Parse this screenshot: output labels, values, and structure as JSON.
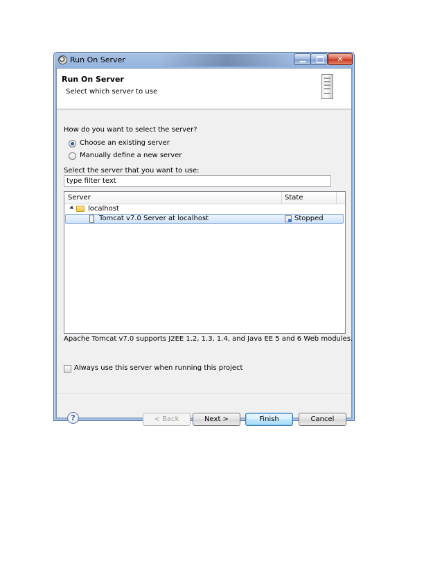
{
  "window": {
    "title": "Run On Server",
    "controls": {
      "minimize": "minimize-icon",
      "maximize": "maximize-icon",
      "close": "✕"
    }
  },
  "banner": {
    "title": "Run On Server",
    "subtitle": "Select which server to use",
    "icon": "server-icon"
  },
  "selection": {
    "question": "How do you want to select the server?",
    "options": [
      {
        "label": "Choose an existing server",
        "selected": true
      },
      {
        "label": "Manually define a new server",
        "selected": false
      }
    ],
    "select_label": "Select the server that you want to use:",
    "filter_value": "type filter text"
  },
  "table": {
    "columns": [
      "Server",
      "State"
    ],
    "host": {
      "label": "localhost",
      "icon": "folder-icon"
    },
    "row": {
      "server": "Tomcat v7.0 Server at localhost",
      "state": "Stopped"
    }
  },
  "description": "Apache Tomcat v7.0 supports J2EE 1.2, 1.3, 1.4, and Java EE 5 and 6 Web modules.",
  "always_use": {
    "label": "Always use this server when running this project",
    "checked": false
  },
  "buttons": {
    "help": "?",
    "back": "< Back",
    "next": "Next >",
    "finish": "Finish",
    "cancel": "Cancel"
  }
}
